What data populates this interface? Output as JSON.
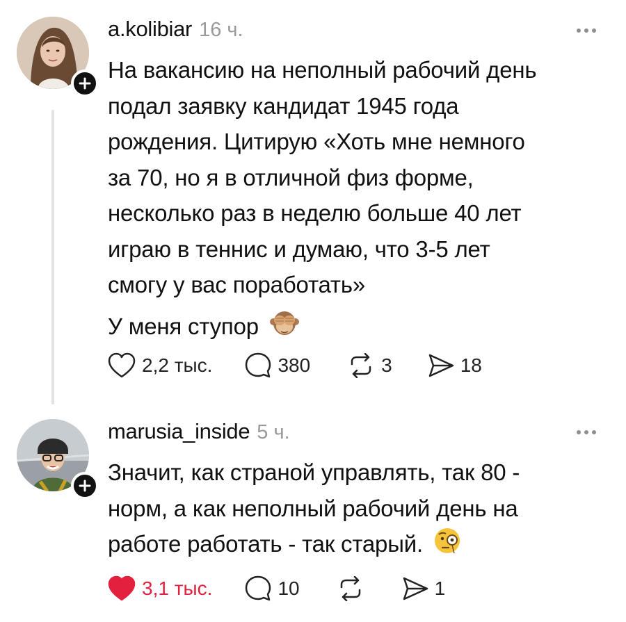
{
  "posts": [
    {
      "username": "a.kolibiar",
      "time": "16 ч.",
      "text_lines": [
        "На вакансию на неполный рабочий день",
        "подал заявку кандидат 1945 года",
        "рождения. Цитирую «Хоть мне немного",
        "за 70, но я в отличной физ форме,",
        "несколько раз в неделю больше 40 лет",
        "играю в теннис и думаю, что 3-5 лет",
        "смогу у вас поработать»"
      ],
      "text_last": "У меня ступор",
      "emoji": "see-no-evil-monkey-emoji",
      "likes": "2,2 тыс.",
      "comments": "380",
      "reposts": "3",
      "shares": "18",
      "liked": false
    },
    {
      "username": "marusia_inside",
      "time": "5 ч.",
      "text_lines": [
        "Значит, как страной управлять, так 80 -",
        "норм, а как неполный рабочий день на",
        "работе работать - так старый."
      ],
      "emoji": "face-with-monocle-emoji",
      "likes": "3,1 тыс.",
      "comments": "10",
      "shares": "1",
      "liked": true
    }
  ],
  "colors": {
    "text": "#111111",
    "muted": "#9a9a9a",
    "like_active": "#e3203d",
    "thread_line": "#e2e2e2"
  }
}
